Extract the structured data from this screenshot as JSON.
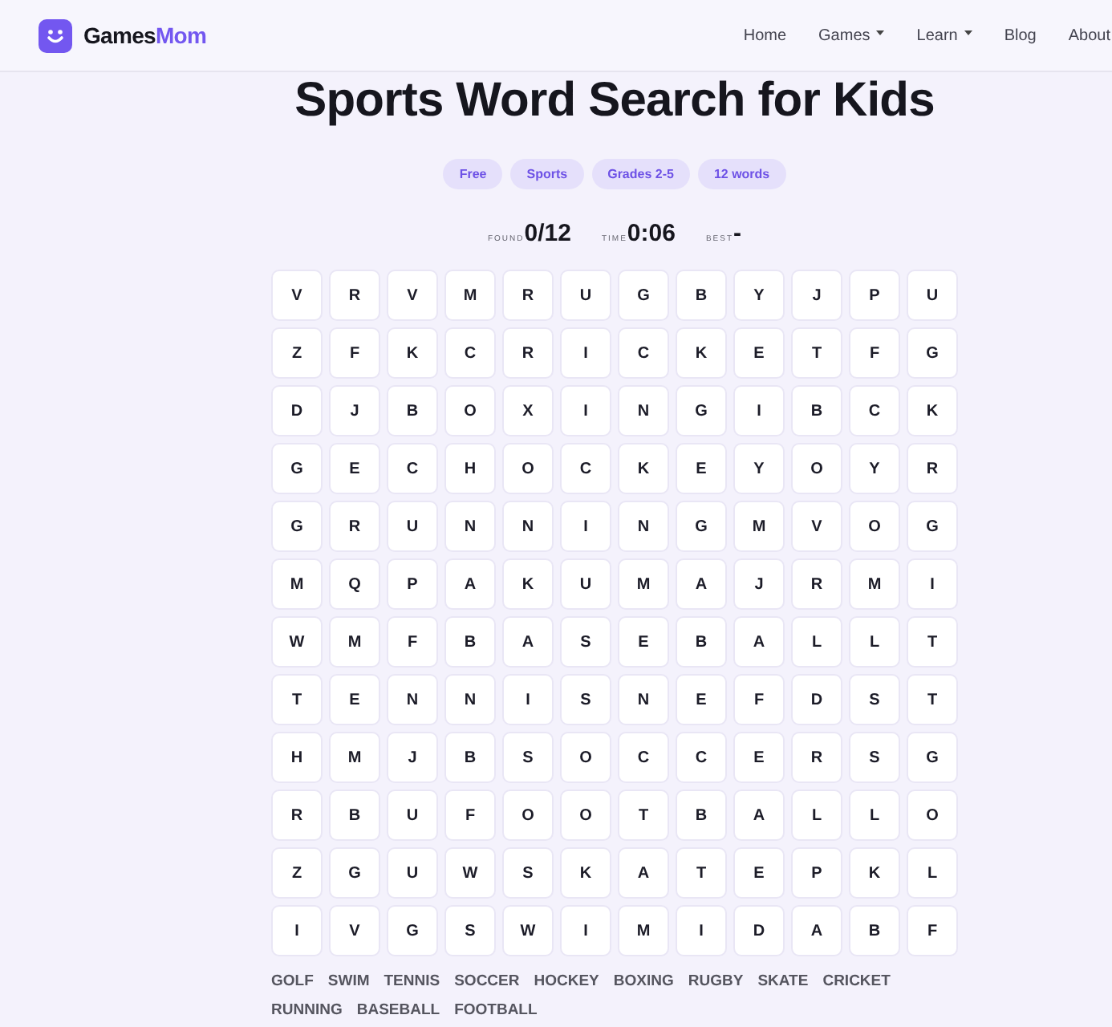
{
  "header": {
    "brand": {
      "first": "Games",
      "second": "Mom"
    },
    "nav": [
      {
        "label": "Home",
        "dropdown": false
      },
      {
        "label": "Games",
        "dropdown": true
      },
      {
        "label": "Learn",
        "dropdown": true
      },
      {
        "label": "Blog",
        "dropdown": false
      },
      {
        "label": "About",
        "dropdown": false
      }
    ]
  },
  "title": "Sports Word Search for Kids",
  "badges": [
    "Free",
    "Sports",
    "Grades 2-5",
    "12 words"
  ],
  "stats": [
    {
      "label": "FOUND",
      "value": "0/12"
    },
    {
      "label": "TIME",
      "value": "0:06"
    },
    {
      "label": "BEST",
      "value": "-"
    }
  ],
  "grid": [
    [
      "V",
      "R",
      "V",
      "M",
      "R",
      "U",
      "G",
      "B",
      "Y",
      "J",
      "P",
      "U"
    ],
    [
      "Z",
      "F",
      "K",
      "C",
      "R",
      "I",
      "C",
      "K",
      "E",
      "T",
      "F",
      "G"
    ],
    [
      "D",
      "J",
      "B",
      "O",
      "X",
      "I",
      "N",
      "G",
      "I",
      "B",
      "C",
      "K"
    ],
    [
      "G",
      "E",
      "C",
      "H",
      "O",
      "C",
      "K",
      "E",
      "Y",
      "O",
      "Y",
      "R"
    ],
    [
      "G",
      "R",
      "U",
      "N",
      "N",
      "I",
      "N",
      "G",
      "M",
      "V",
      "O",
      "G"
    ],
    [
      "M",
      "Q",
      "P",
      "A",
      "K",
      "U",
      "M",
      "A",
      "J",
      "R",
      "M",
      "I"
    ],
    [
      "W",
      "M",
      "F",
      "B",
      "A",
      "S",
      "E",
      "B",
      "A",
      "L",
      "L",
      "T"
    ],
    [
      "T",
      "E",
      "N",
      "N",
      "I",
      "S",
      "N",
      "E",
      "F",
      "D",
      "S",
      "T"
    ],
    [
      "H",
      "M",
      "J",
      "B",
      "S",
      "O",
      "C",
      "C",
      "E",
      "R",
      "S",
      "G"
    ],
    [
      "R",
      "B",
      "U",
      "F",
      "O",
      "O",
      "T",
      "B",
      "A",
      "L",
      "L",
      "O"
    ],
    [
      "Z",
      "G",
      "U",
      "W",
      "S",
      "K",
      "A",
      "T",
      "E",
      "P",
      "K",
      "L"
    ],
    [
      "I",
      "V",
      "G",
      "S",
      "W",
      "I",
      "M",
      "I",
      "D",
      "A",
      "B",
      "F"
    ]
  ],
  "words": [
    "GOLF",
    "SWIM",
    "TENNIS",
    "SOCCER",
    "HOCKEY",
    "BOXING",
    "RUGBY",
    "SKATE",
    "CRICKET",
    "RUNNING",
    "BASEBALL",
    "FOOTBALL"
  ]
}
